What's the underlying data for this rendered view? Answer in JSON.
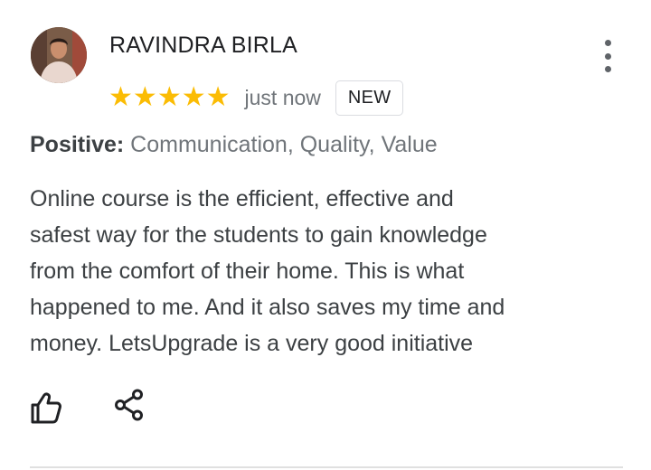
{
  "review": {
    "reviewer_name": "RAVINDRA BIRLA",
    "rating": 5,
    "stars": [
      "★",
      "★",
      "★",
      "★",
      "★"
    ],
    "time": "just now",
    "badge": "NEW",
    "positive_label": "Positive:",
    "positive_values": "Communication, Quality, Value",
    "text_lines": [
      "Online course is the efficient, effective and",
      "safest way for the students to gain knowledge",
      "from the comfort of their home. This is what",
      "happened to me. And it also saves my time and",
      "money. LetsUpgrade is a very good initiative"
    ]
  },
  "icons": {
    "more": "more-vert-icon",
    "like": "thumb-up-icon",
    "share": "share-icon",
    "star": "star-icon"
  },
  "colors": {
    "star": "#fbbc04",
    "name": "#202124",
    "secondary_text": "#70757a",
    "body_text": "#3c4043",
    "badge_border": "#dadce0",
    "divider": "#e0e0e0"
  }
}
